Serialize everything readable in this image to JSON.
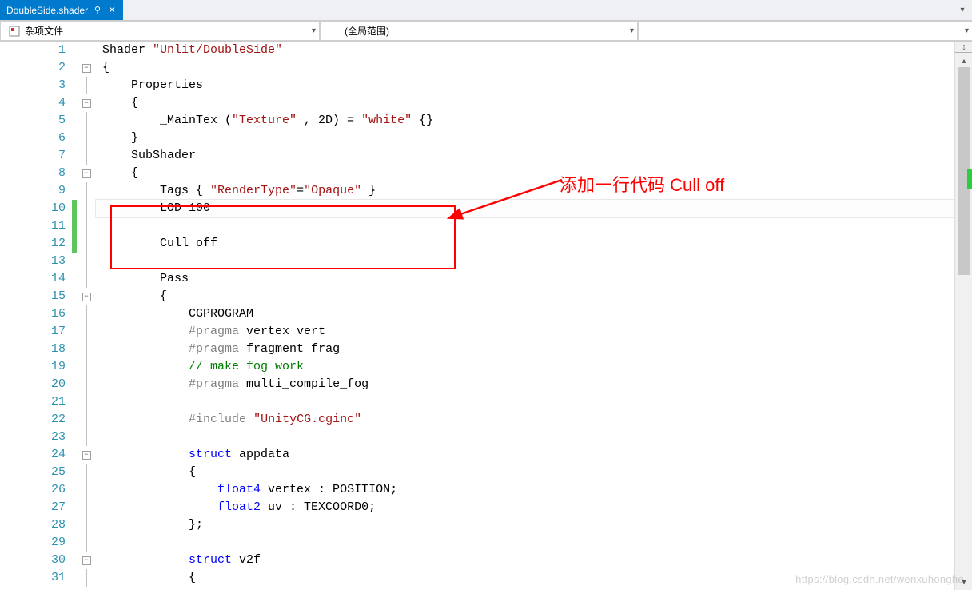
{
  "tab": {
    "title": "DoubleSide.shader"
  },
  "nav": {
    "left": "杂项文件",
    "mid": "(全局范围)",
    "right": ""
  },
  "annotation": {
    "text": "添加一行代码 Cull off"
  },
  "watermark": "https://blog.csdn.net/wenxuhonghe",
  "lines": [
    {
      "n": 1,
      "fold": "",
      "chg": "",
      "seg": [
        [
          "",
          "Shader "
        ],
        [
          "s-str",
          "\"Unlit/DoubleSide\""
        ]
      ]
    },
    {
      "n": 2,
      "fold": "box",
      "chg": "",
      "seg": [
        [
          "",
          "{"
        ]
      ]
    },
    {
      "n": 3,
      "fold": "line",
      "chg": "",
      "seg": [
        [
          "",
          "    Properties"
        ]
      ]
    },
    {
      "n": 4,
      "fold": "box",
      "chg": "",
      "seg": [
        [
          "",
          "    {"
        ]
      ]
    },
    {
      "n": 5,
      "fold": "line",
      "chg": "",
      "seg": [
        [
          "",
          "        _MainTex ("
        ],
        [
          "s-str",
          "\"Texture\""
        ],
        [
          "",
          " , 2D) = "
        ],
        [
          "s-str",
          "\"white\""
        ],
        [
          "",
          " {}"
        ]
      ]
    },
    {
      "n": 6,
      "fold": "line",
      "chg": "",
      "seg": [
        [
          "",
          "    }"
        ]
      ]
    },
    {
      "n": 7,
      "fold": "line",
      "chg": "",
      "seg": [
        [
          "",
          "    SubShader"
        ]
      ]
    },
    {
      "n": 8,
      "fold": "box",
      "chg": "",
      "seg": [
        [
          "",
          "    {"
        ]
      ]
    },
    {
      "n": 9,
      "fold": "line",
      "chg": "",
      "seg": [
        [
          "",
          "        Tags { "
        ],
        [
          "s-str",
          "\"RenderType\""
        ],
        [
          "",
          "="
        ],
        [
          "s-str",
          "\"Opaque\""
        ],
        [
          "",
          " }"
        ]
      ]
    },
    {
      "n": 10,
      "fold": "line",
      "chg": "green",
      "cur": true,
      "seg": [
        [
          "",
          "        LOD 100"
        ]
      ]
    },
    {
      "n": 11,
      "fold": "line",
      "chg": "green",
      "seg": [
        [
          "",
          ""
        ]
      ]
    },
    {
      "n": 12,
      "fold": "line",
      "chg": "green",
      "seg": [
        [
          "",
          "        Cull off"
        ]
      ]
    },
    {
      "n": 13,
      "fold": "line",
      "chg": "",
      "seg": [
        [
          "",
          ""
        ]
      ]
    },
    {
      "n": 14,
      "fold": "line",
      "chg": "",
      "seg": [
        [
          "",
          "        Pass"
        ]
      ]
    },
    {
      "n": 15,
      "fold": "box",
      "chg": "",
      "seg": [
        [
          "",
          "        {"
        ]
      ]
    },
    {
      "n": 16,
      "fold": "line",
      "chg": "",
      "seg": [
        [
          "",
          "            CGPROGRAM"
        ]
      ]
    },
    {
      "n": 17,
      "fold": "line",
      "chg": "",
      "seg": [
        [
          "",
          "            "
        ],
        [
          "s-pre",
          "#pragma"
        ],
        [
          "",
          " vertex vert"
        ]
      ]
    },
    {
      "n": 18,
      "fold": "line",
      "chg": "",
      "seg": [
        [
          "",
          "            "
        ],
        [
          "s-pre",
          "#pragma"
        ],
        [
          "",
          " fragment frag"
        ]
      ]
    },
    {
      "n": 19,
      "fold": "line",
      "chg": "",
      "seg": [
        [
          "",
          "            "
        ],
        [
          "s-com",
          "// make fog work"
        ]
      ]
    },
    {
      "n": 20,
      "fold": "line",
      "chg": "",
      "seg": [
        [
          "",
          "            "
        ],
        [
          "s-pre",
          "#pragma"
        ],
        [
          "",
          " multi_compile_fog"
        ]
      ]
    },
    {
      "n": 21,
      "fold": "line",
      "chg": "",
      "seg": [
        [
          "",
          ""
        ]
      ]
    },
    {
      "n": 22,
      "fold": "line",
      "chg": "",
      "seg": [
        [
          "",
          "            "
        ],
        [
          "s-pre",
          "#include"
        ],
        [
          "",
          " "
        ],
        [
          "s-str",
          "\"UnityCG.cginc\""
        ]
      ]
    },
    {
      "n": 23,
      "fold": "line",
      "chg": "",
      "seg": [
        [
          "",
          ""
        ]
      ]
    },
    {
      "n": 24,
      "fold": "box",
      "chg": "",
      "seg": [
        [
          "",
          "            "
        ],
        [
          "s-key",
          "struct"
        ],
        [
          "",
          " appdata"
        ]
      ]
    },
    {
      "n": 25,
      "fold": "line",
      "chg": "",
      "seg": [
        [
          "",
          "            {"
        ]
      ]
    },
    {
      "n": 26,
      "fold": "line",
      "chg": "",
      "seg": [
        [
          "",
          "                "
        ],
        [
          "s-key",
          "float4"
        ],
        [
          "",
          " vertex : POSITION;"
        ]
      ]
    },
    {
      "n": 27,
      "fold": "line",
      "chg": "",
      "seg": [
        [
          "",
          "                "
        ],
        [
          "s-key",
          "float2"
        ],
        [
          "",
          " uv : TEXCOORD0;"
        ]
      ]
    },
    {
      "n": 28,
      "fold": "line",
      "chg": "",
      "seg": [
        [
          "",
          "            };"
        ]
      ]
    },
    {
      "n": 29,
      "fold": "line",
      "chg": "",
      "seg": [
        [
          "",
          ""
        ]
      ]
    },
    {
      "n": 30,
      "fold": "box",
      "chg": "",
      "seg": [
        [
          "",
          "            "
        ],
        [
          "s-key",
          "struct"
        ],
        [
          "",
          " v2f"
        ]
      ]
    },
    {
      "n": 31,
      "fold": "line",
      "chg": "",
      "seg": [
        [
          "",
          "            {"
        ]
      ]
    }
  ]
}
